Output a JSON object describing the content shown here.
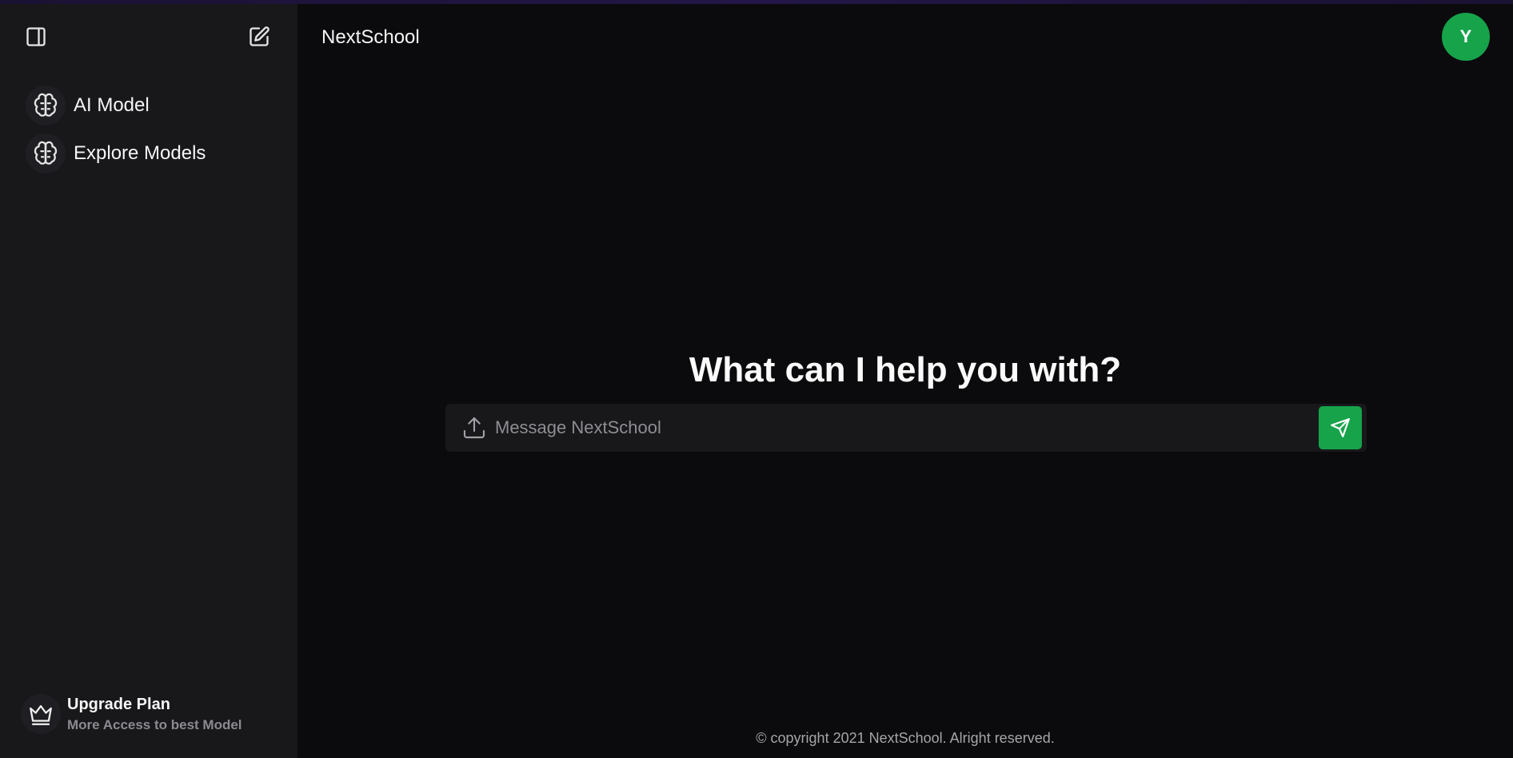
{
  "header": {
    "title": "NextSchool",
    "avatar_initial": "Y"
  },
  "sidebar": {
    "items": [
      {
        "label": "AI Model",
        "icon": "brain-icon"
      },
      {
        "label": "Explore Models",
        "icon": "brain-icon"
      }
    ],
    "upgrade": {
      "title": "Upgrade Plan",
      "subtitle": "More Access to best Model",
      "icon": "crown-icon"
    }
  },
  "main": {
    "heading": "What can I help you with?",
    "input_placeholder": "Message NextSchool"
  },
  "footer": {
    "copyright": "© copyright 2021 NextSchool. Alright reserved."
  },
  "colors": {
    "accent": "#16a34a",
    "sidebar_bg": "#18181b",
    "page_bg": "#0b0b0d"
  }
}
